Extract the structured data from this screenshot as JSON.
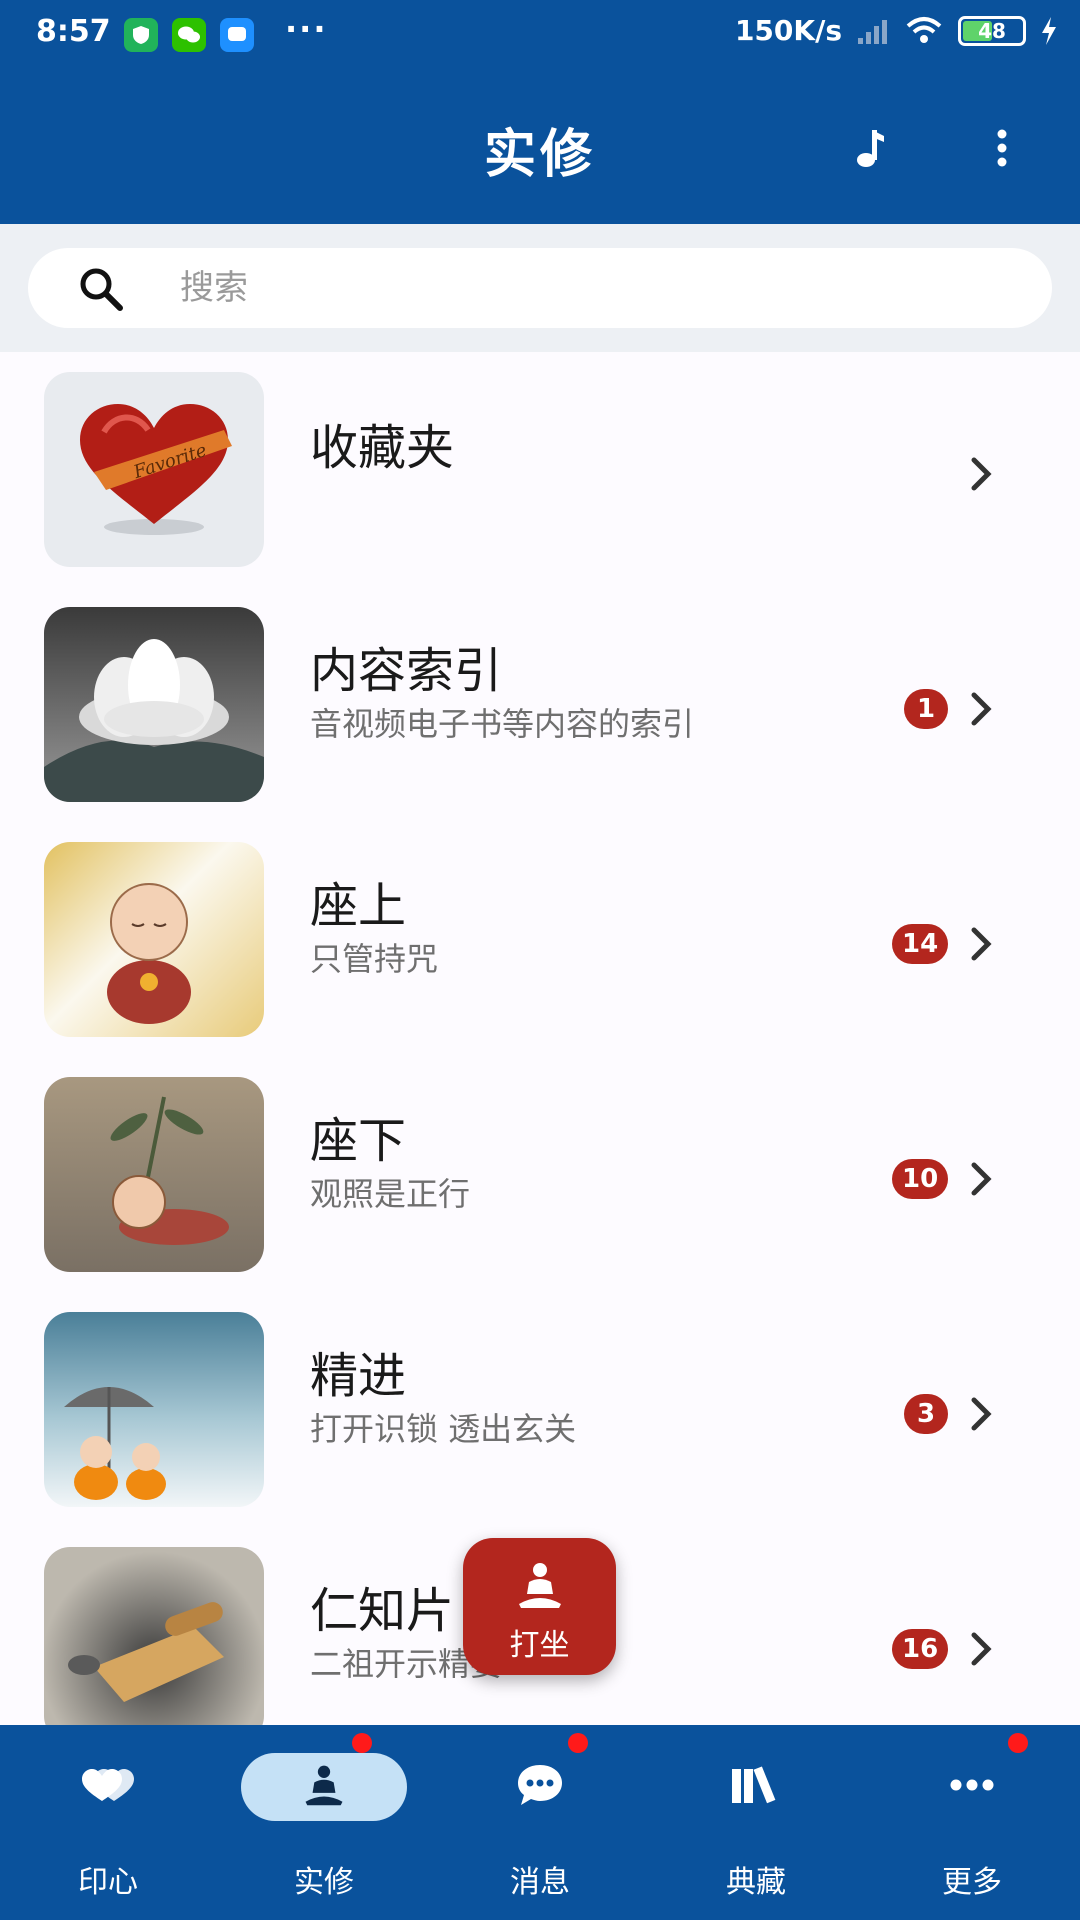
{
  "status_bar": {
    "time": "8:57",
    "more": "···",
    "speed": "150K/s",
    "battery": "48"
  },
  "header": {
    "title": "实修"
  },
  "search": {
    "placeholder": "搜索"
  },
  "list": [
    {
      "title": "收藏夹",
      "subtitle": "",
      "badge": ""
    },
    {
      "title": "内容索引",
      "subtitle": "音视频电子书等内容的索引",
      "badge": "1"
    },
    {
      "title": "座上",
      "subtitle": "只管持咒",
      "badge": "14"
    },
    {
      "title": "座下",
      "subtitle": "观照是正行",
      "badge": "10"
    },
    {
      "title": "精进",
      "subtitle": "打开识锁 透出玄关",
      "badge": "3"
    },
    {
      "title": "仁知片",
      "subtitle": "二祖开示精要",
      "badge": "16"
    }
  ],
  "fab": {
    "label": "打坐"
  },
  "bottom_nav": [
    {
      "label": "印心",
      "icon": "hearts-icon"
    },
    {
      "label": "实修",
      "icon": "meditation-icon"
    },
    {
      "label": "消息",
      "icon": "chat-icon"
    },
    {
      "label": "典藏",
      "icon": "books-icon"
    },
    {
      "label": "更多",
      "icon": "more-icon"
    }
  ],
  "colors": {
    "primary": "#0a529c",
    "badge": "#b3261e",
    "active_pill": "#c5e1f6",
    "notify_dot": "#ff1a1a"
  }
}
